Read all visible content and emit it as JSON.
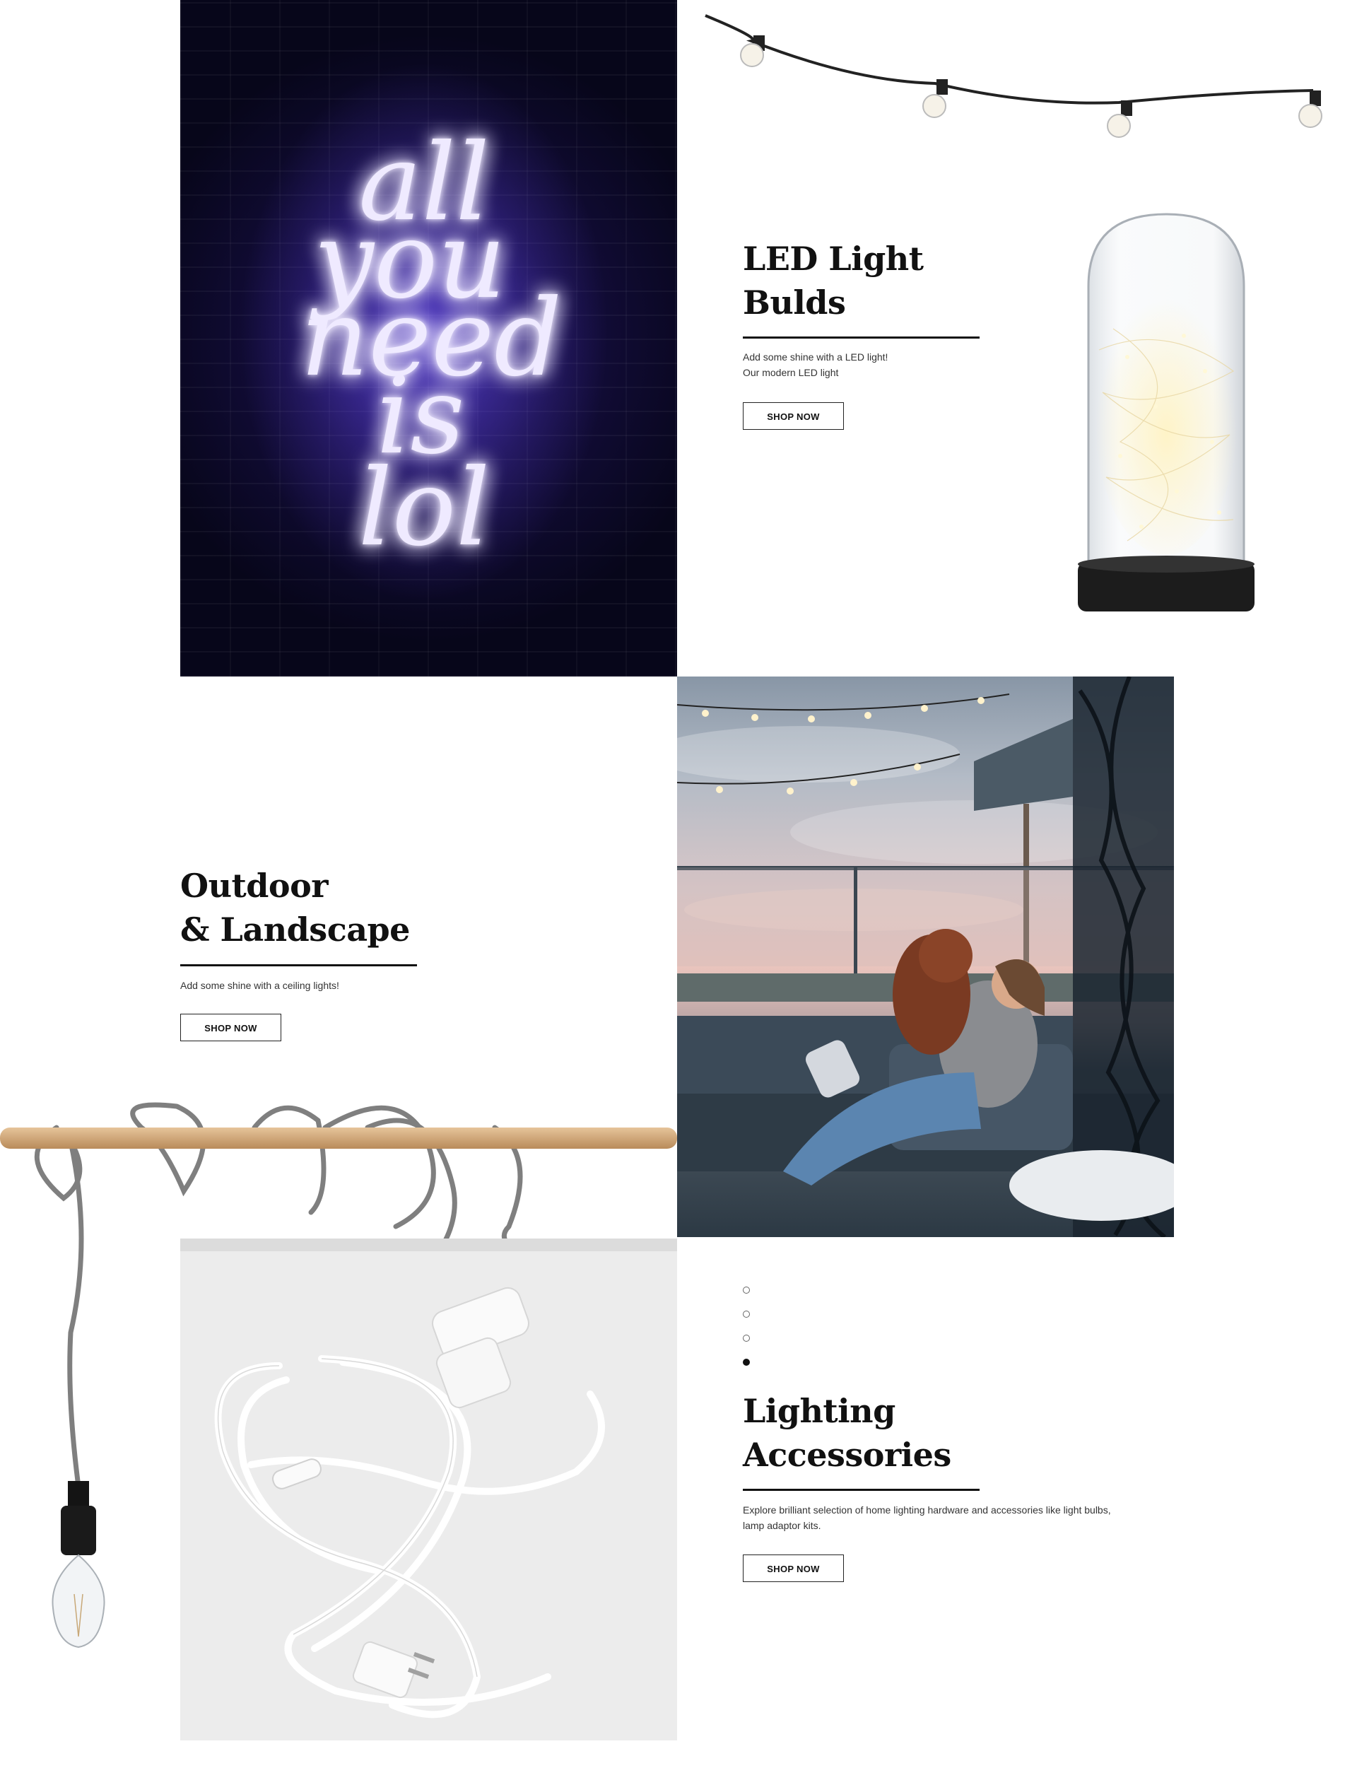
{
  "sections": {
    "led": {
      "title_line1": "LED Light",
      "title_line2": "Bulds",
      "desc_line1": "Add some shine with a LED light!",
      "desc_line2": "Our modern LED light",
      "button": "SHOP NOW"
    },
    "outdoor": {
      "title_line1": "Outdoor",
      "title_line2": "& Landscape",
      "desc_line1": "Add some shine with a ceiling lights!",
      "button": "SHOP NOW"
    },
    "accessories": {
      "title_line1": "Lighting",
      "title_line2": "Accessories",
      "desc_line1": "Explore brilliant selection of home lighting hardware and accessories like light bulbs,",
      "desc_line2": "lamp adaptor kits.",
      "button": "SHOP NOW"
    }
  },
  "neon_sign": {
    "line1": "all",
    "line2": "you",
    "line3": "need",
    "line4": "is",
    "line5": "lol"
  },
  "carousel": {
    "count": 4,
    "active_index": 3
  },
  "colors": {
    "neon": "#7a5cff",
    "text": "#111111",
    "background": "#ffffff"
  }
}
